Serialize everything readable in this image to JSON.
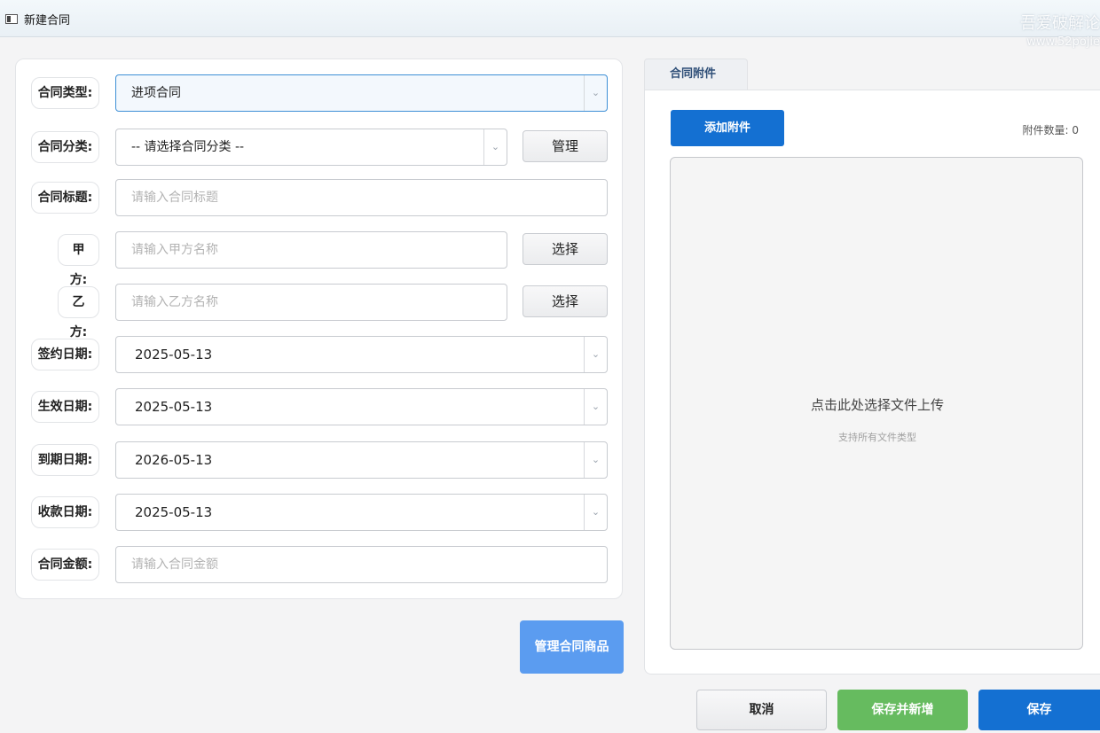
{
  "window": {
    "title": "新建合同",
    "icon": "window-icon"
  },
  "watermark": {
    "text": "吾爱破解论",
    "url": "www.52pojie"
  },
  "form": {
    "contract_type": {
      "label": "合同类型:",
      "value": "进项合同"
    },
    "contract_category": {
      "label": "合同分类:",
      "value": "-- 请选择合同分类 --",
      "manage_label": "管理"
    },
    "contract_title": {
      "label": "合同标题:",
      "placeholder": "请输入合同标题"
    },
    "party_a": {
      "label": "甲方:",
      "placeholder": "请输入甲方名称",
      "select_label": "选择"
    },
    "party_b": {
      "label": "乙方:",
      "placeholder": "请输入乙方名称",
      "select_label": "选择"
    },
    "sign_date": {
      "label": "签约日期:",
      "value": "2025-05-13"
    },
    "effective_date": {
      "label": "生效日期:",
      "value": "2025-05-13"
    },
    "expiry_date": {
      "label": "到期日期:",
      "value": "2026-05-13"
    },
    "payment_date": {
      "label": "收款日期:",
      "value": "2025-05-13"
    },
    "amount": {
      "label": "合同金额:",
      "placeholder": "请输入合同金额"
    },
    "dropdown_icon": "chevron-down-icon"
  },
  "manage_goods_label": "管理合同商品",
  "attachments": {
    "tab_label": "合同附件",
    "add_label": "添加附件",
    "count_label": "附件数量: 0",
    "dropzone_main": "点击此处选择文件上传",
    "dropzone_sub": "支持所有文件类型"
  },
  "footer": {
    "cancel_label": "取消",
    "save_new_label": "保存并新增",
    "save_label": "保存"
  },
  "colors": {
    "primary": "#1470d2",
    "success": "#66bb5f",
    "light_blue": "#5b9cf0"
  }
}
